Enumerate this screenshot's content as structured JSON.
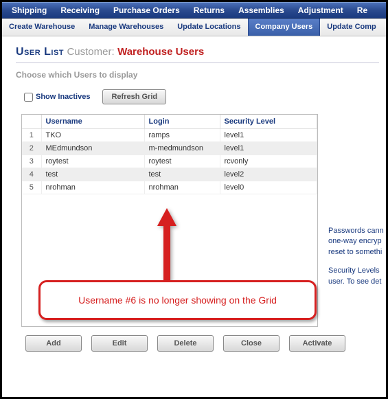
{
  "menubar": [
    "Shipping",
    "Receiving",
    "Purchase Orders",
    "Returns",
    "Assemblies",
    "Adjustment",
    "Re"
  ],
  "subtabs": {
    "items": [
      "Create Warehouse",
      "Manage Warehouses",
      "Update Locations",
      "Company Users",
      "Update Comp"
    ],
    "active_index": 3
  },
  "title": {
    "t1": "User List",
    "t2": "Customer:",
    "t3": "Warehouse Users"
  },
  "choose_label": "Choose which Users to display",
  "filter": {
    "show_inactives_label": "Show Inactives",
    "show_inactives_checked": false,
    "refresh_label": "Refresh Grid"
  },
  "grid": {
    "headers": {
      "rownum": "",
      "username": "Username",
      "login": "Login",
      "security": "Security Level"
    },
    "rows": [
      {
        "n": "1",
        "username": "TKO",
        "login": "ramps",
        "security": "level1"
      },
      {
        "n": "2",
        "username": "MEdmundson",
        "login": "m-medmundson",
        "security": "level1"
      },
      {
        "n": "3",
        "username": "roytest",
        "login": "roytest",
        "security": "rcvonly"
      },
      {
        "n": "4",
        "username": "test",
        "login": "test",
        "security": "level2"
      },
      {
        "n": "5",
        "username": "nrohman",
        "login": "nrohman",
        "security": "level0"
      }
    ]
  },
  "sidetext": {
    "p1": "Passwords cann one-way encryp reset to somethi",
    "p2": "Security Levels user. To see det"
  },
  "footer": {
    "add": "Add",
    "edit": "Edit",
    "delete": "Delete",
    "close": "Close",
    "activate": "Activate"
  },
  "callout_text": "Username #6 is no longer showing on the Grid",
  "colors": {
    "brand_blue": "#1a3a7f",
    "accent_red": "#d62020"
  }
}
